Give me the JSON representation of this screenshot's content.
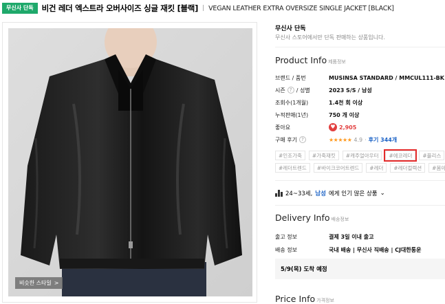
{
  "header": {
    "badge": "무신사 단독",
    "title_kr": "비건 레더 엑스트라 오버사이즈 싱글 재킷 [블랙]",
    "separator": "|",
    "title_en": "VEGAN LEATHER EXTRA OVERSIZE SINGLE JACKET [BLACK]"
  },
  "image": {
    "similar_style_label": "비슷한 스타일",
    "similar_style_arrow": ">"
  },
  "exclusive": {
    "title": "무신사 단독",
    "description": "무신사 스토어에서만 단독 판매하는 상품입니다."
  },
  "product_info": {
    "title": "Product Info",
    "subtitle": "제품정보",
    "rows": [
      {
        "label": "브랜드 / 품번",
        "value": "MUSINSA STANDARD / MMCUL111-BK"
      },
      {
        "label": "시즌",
        "label2": "/ 성별",
        "value": "2023 S/S / 남성"
      },
      {
        "label": "조회수(1개월)",
        "value": "1.4천 회 이상"
      },
      {
        "label": "누적판매(1년)",
        "value": "750 개 이상"
      },
      {
        "label": "좋아요",
        "value": "2,905"
      },
      {
        "label": "구매 후기",
        "stars": "★★★★★",
        "rating": "4.9",
        "separator": "·",
        "reviews": "후기 344개"
      }
    ],
    "question_mark": "?",
    "heart": "♥"
  },
  "tags": {
    "row1": [
      "#인조가죽",
      "#가죽재킷",
      "#캐주얼아우터",
      "#에코레더",
      "#플리스"
    ],
    "row2": [
      "#레더트렌드",
      "#바이크코어트렌드",
      "#레더",
      "#레더컬렉션",
      "#봄아"
    ],
    "highlighted": "#에코레더"
  },
  "popularity": {
    "age": "24~33세,",
    "gender": "남성",
    "suffix": "에게 인기 많은 상품",
    "chevron": "⌄"
  },
  "delivery_info": {
    "title": "Delivery Info",
    "subtitle": "배송정보",
    "rows": [
      {
        "label": "출고 정보",
        "value": "결제 3일 이내 출고"
      },
      {
        "label": "배송 정보",
        "value": "국내 배송 | 무신사 직배송 | CJ대한통운"
      }
    ],
    "arrival": "5/9(목) 도착 예정"
  },
  "price_info": {
    "title": "Price Info",
    "subtitle": "가격정보"
  }
}
